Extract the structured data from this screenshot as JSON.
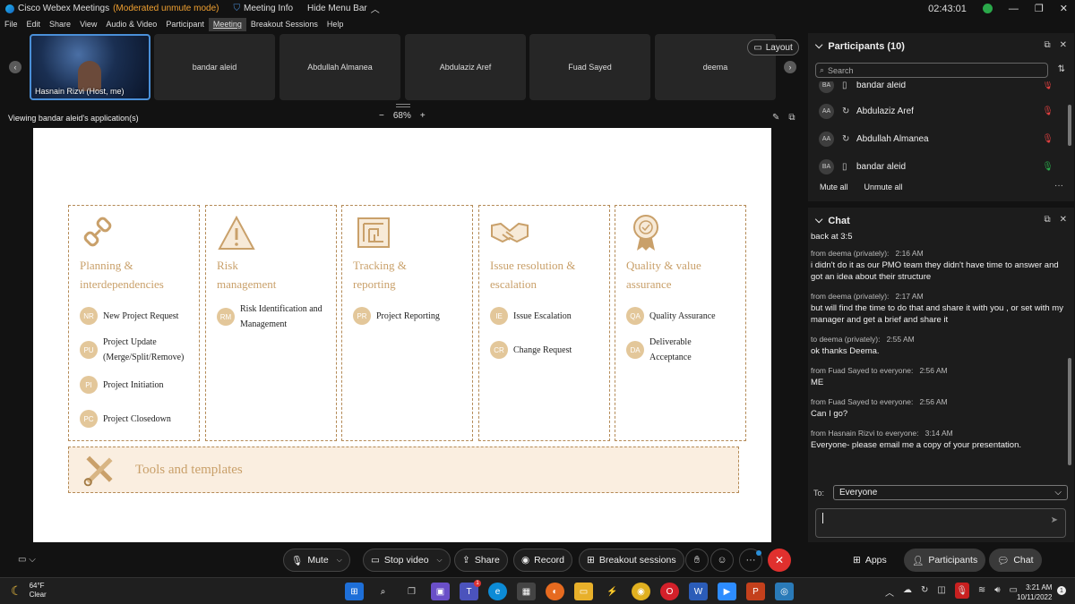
{
  "titlebar": {
    "app_name": "Cisco Webex Meetings",
    "mode": "(Moderated unmute mode)",
    "meeting_info": "Meeting Info",
    "hide_menu": "Hide Menu Bar",
    "clock": "02:43:01"
  },
  "menu": [
    "File",
    "Edit",
    "Share",
    "View",
    "Audio & Video",
    "Participant",
    "Meeting",
    "Breakout Sessions",
    "Help"
  ],
  "video_strip": {
    "self_name": "Hasnain Rizvi (Host, me)",
    "tiles": [
      "bandar aleid",
      "Abdullah Almanea",
      "Abdulaziz Aref",
      "Fuad Sayed",
      "deema"
    ],
    "layout_label": "Layout"
  },
  "share": {
    "viewing_text": "Viewing bandar aleid's application(s)",
    "zoom_minus": "−",
    "zoom_level": "68%",
    "zoom_plus": "+"
  },
  "slide": {
    "columns": [
      {
        "title": "Planning & interdependencies",
        "items": [
          {
            "abbr": "NR",
            "text": "New Project Request"
          },
          {
            "abbr": "PU",
            "text": "Project Update (Merge/Split/Remove)"
          },
          {
            "abbr": "PI",
            "text": "Project Initiation"
          },
          {
            "abbr": "PC",
            "text": "Project Closedown"
          }
        ]
      },
      {
        "title": "Risk management",
        "items": [
          {
            "abbr": "RM",
            "text": "Risk Identification and Management"
          }
        ]
      },
      {
        "title": "Tracking & reporting",
        "items": [
          {
            "abbr": "PR",
            "text": "Project Reporting"
          }
        ]
      },
      {
        "title": "Issue resolution & escalation",
        "items": [
          {
            "abbr": "IE",
            "text": "Issue Escalation"
          },
          {
            "abbr": "CR",
            "text": "Change Request"
          }
        ]
      },
      {
        "title": "Quality & value assurance",
        "items": [
          {
            "abbr": "QA",
            "text": "Quality Assurance"
          },
          {
            "abbr": "DA",
            "text": "Deliverable Acceptance"
          }
        ]
      }
    ],
    "tools_label": "Tools and templates",
    "accent_color": "#c9a06a",
    "badge_color": "#e3c79a"
  },
  "participants": {
    "title": "Participants (10)",
    "search_placeholder": "Search",
    "list": [
      {
        "initials": "BA",
        "name": "bandar aleid",
        "muted": true
      },
      {
        "initials": "AA",
        "name": "Abdulaziz Aref",
        "muted": true
      },
      {
        "initials": "AA",
        "name": "Abdullah Almanea",
        "muted": true
      },
      {
        "initials": "BA",
        "name": "bandar aleid",
        "muted": false
      }
    ],
    "mute_all": "Mute all",
    "unmute_all": "Unmute all"
  },
  "chat": {
    "title": "Chat",
    "partial_top": "back at 3:5",
    "messages": [
      {
        "from": "from deema (privately):",
        "time": "2:16 AM",
        "body": "i didn't do it as our PMO team they didn't  have time to answer and got an idea about their structure"
      },
      {
        "from": "from deema (privately):",
        "time": "2:17 AM",
        "body": "but will find the time to do that and share it with you , or set with my manager and get a brief and share it"
      },
      {
        "from": "to deema (privately):",
        "time": "2:55 AM",
        "body": "ok thanks Deema."
      },
      {
        "from": "from Fuad Sayed to everyone:",
        "time": "2:56 AM",
        "body": "ME"
      },
      {
        "from": "from Fuad Sayed to everyone:",
        "time": "2:56 AM",
        "body": "Can I go?"
      },
      {
        "from": "from Hasnain Rizvi to everyone:",
        "time": "3:14 AM",
        "body": "Everyone- please email me a copy of your presentation."
      }
    ],
    "to_label": "To:",
    "to_value": "Everyone"
  },
  "controls": {
    "mute": "Mute",
    "stop_video": "Stop video",
    "share": "Share",
    "record": "Record",
    "breakout": "Breakout sessions",
    "apps": "Apps",
    "participants": "Participants",
    "chat": "Chat"
  },
  "taskbar": {
    "temp": "64°F",
    "weather": "Clear",
    "time": "3:21 AM",
    "date": "10/11/2022",
    "notification_count": "1"
  }
}
